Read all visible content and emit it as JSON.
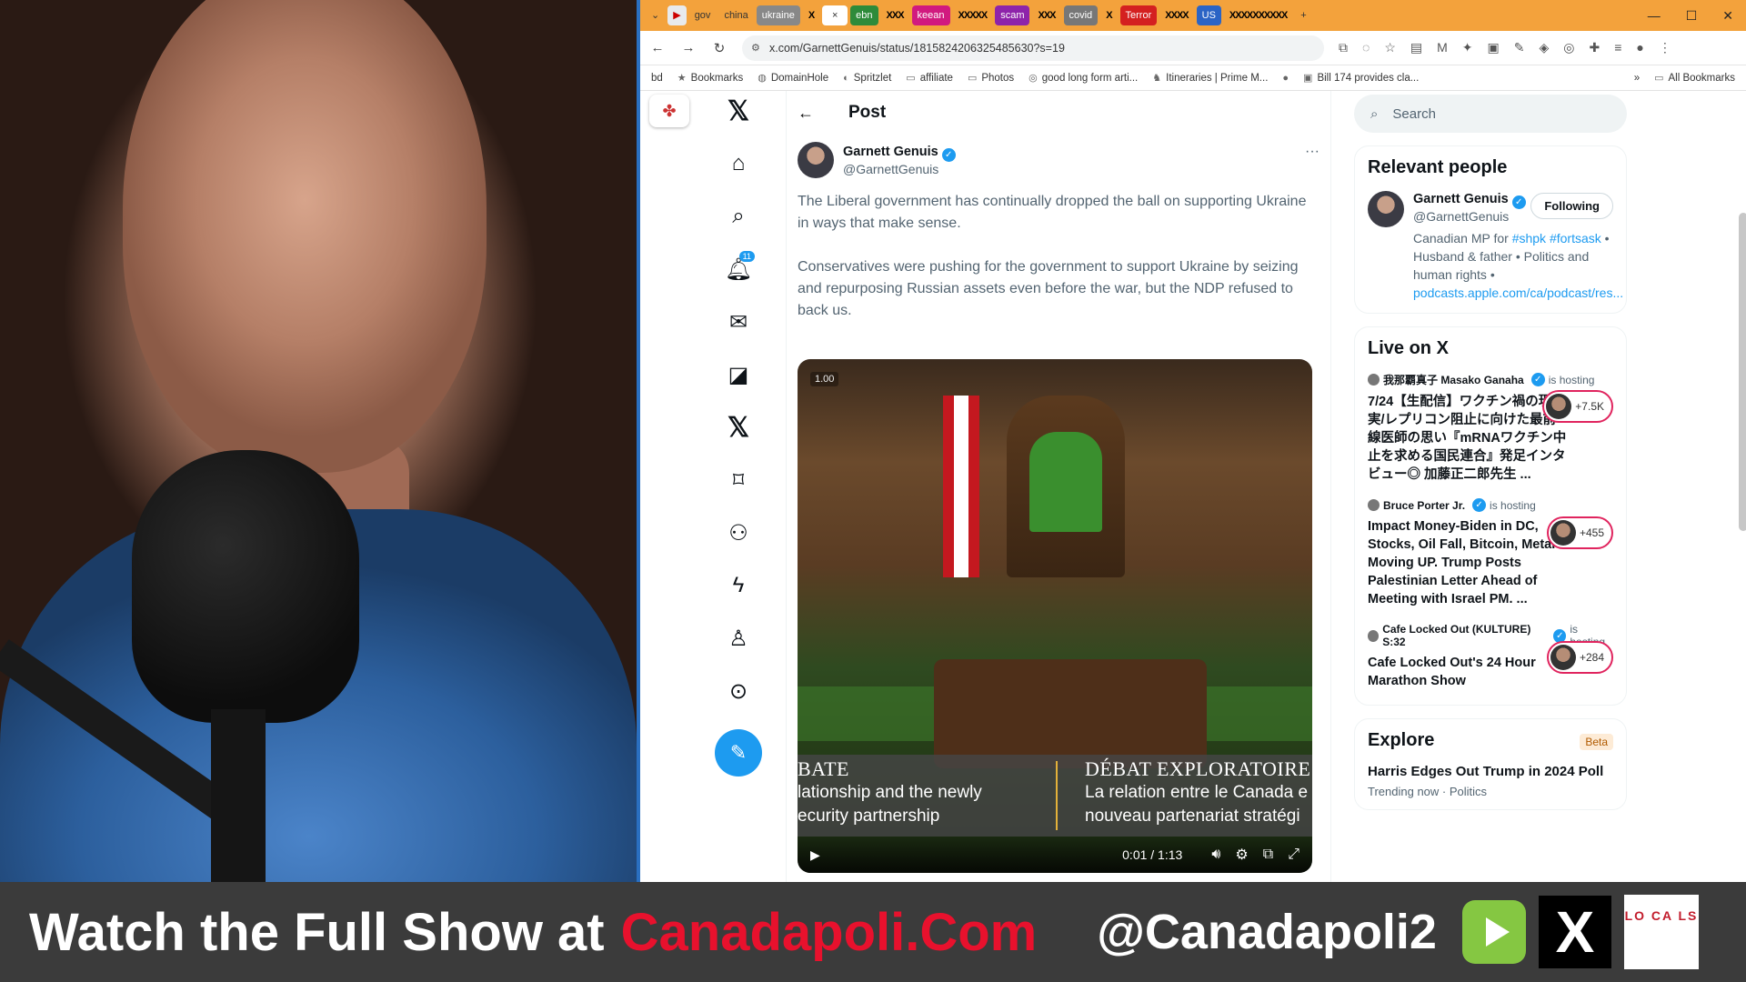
{
  "browser": {
    "tabs": [
      "gov",
      "china",
      "ukraine",
      "X",
      "×",
      "ebn",
      "XXX",
      "keean",
      "XXXXX",
      "scam",
      "XXX",
      "covid",
      "X",
      "Terror",
      "XXXX",
      "US",
      "XXXXXXXXXX",
      "+"
    ],
    "url": "x.com/GarnettGenuis/status/1815824206325485630?s=19",
    "bookmarks": [
      "bd",
      "Bookmarks",
      "DomainHole",
      "Spritzlet",
      "affiliate",
      "Photos",
      "good long form arti...",
      "Itineraries | Prime M...",
      "Bill 174 provides cla...",
      "»",
      "All Bookmarks"
    ],
    "tab_colors": {
      "orange": "#f3a23c",
      "green": "#2e8b3a",
      "magenta": "#d11a7f",
      "red": "#d42020",
      "blue": "#2b64c5",
      "gray": "#888888"
    }
  },
  "xnav": {
    "items": [
      "home-icon",
      "search-icon",
      "notifications-icon",
      "messages-icon",
      "grok-icon",
      "premium-icon",
      "bookmarks-icon",
      "communities-icon",
      "verified-orgs-icon",
      "profile-icon",
      "more-icon"
    ],
    "notification_count": "11",
    "compose_icon": "feather-icon"
  },
  "post": {
    "header": "Post",
    "author_name": "Garnett Genuis",
    "author_handle": "@GarnettGenuis",
    "more": "···",
    "para1": "The Liberal government has continually dropped the ball on supporting Ukraine in ways that make sense.",
    "para2": "Conservatives were pushing for the government to support Ukraine by seizing and repurposing Russian assets even before the war, but the NDP refused to back us.",
    "video": {
      "speed": "1.00",
      "cap_left_title": "BATE",
      "cap_left_line1": "lationship and the newly",
      "cap_left_line2": "ecurity partnership",
      "cap_right_title": "DÉBAT EXPLORATOIRE",
      "cap_right_line1": "La relation entre le Canada e",
      "cap_right_line2": "nouveau partenariat stratégi",
      "time": "0:01 / 1:13"
    }
  },
  "sidebar": {
    "search_placeholder": "Search",
    "relevant_title": "Relevant people",
    "person": {
      "name": "Garnett Genuis",
      "handle": "@GarnettGenuis",
      "follow_label": "Following",
      "bio_prefix": "Canadian MP for ",
      "tag1": "#shpk",
      "tag2": "#fortsask",
      "bio_rest": " • Husband & father • Politics and human rights •",
      "link": "podcasts.apple.com/ca/podcast/res..."
    },
    "live_title": "Live on X",
    "live": [
      {
        "host": "我那覇真子 Masako Ganaha",
        "status": "is hosting",
        "title": "7/24【生配信】ワクチン禍の現実/レプリコン阻止に向けた最前線医師の思い『mRNAワクチン中止を求める国民連合』発足インタビュー◎ 加藤正二郎先生 ...",
        "count": "+7.5K"
      },
      {
        "host": "Bruce Porter Jr.",
        "status": "is hosting",
        "title": "Impact Money-Biden in DC, Stocks, Oil Fall, Bitcoin, Metal Moving UP. Trump Posts Palestinian Letter Ahead of Meeting with Israel PM. ...",
        "count": "+455"
      },
      {
        "host": "Cafe Locked Out (KULTURE) S:32",
        "status": "is hosting",
        "title": "Cafe Locked Out's 24 Hour Marathon Show",
        "count": "+284"
      }
    ],
    "explore_title": "Explore",
    "explore_badge": "Beta",
    "trend_title": "Harris Edges Out Trump in 2024 Poll",
    "trend_meta": "Trending now · Politics"
  },
  "banner": {
    "watch": "Watch the Full Show at",
    "site": "Canadapoli.Com",
    "handle": "@Canadapoli2",
    "x_logo": "X",
    "locals_logo": "LO CA LS",
    "accent": "#e8112d"
  }
}
